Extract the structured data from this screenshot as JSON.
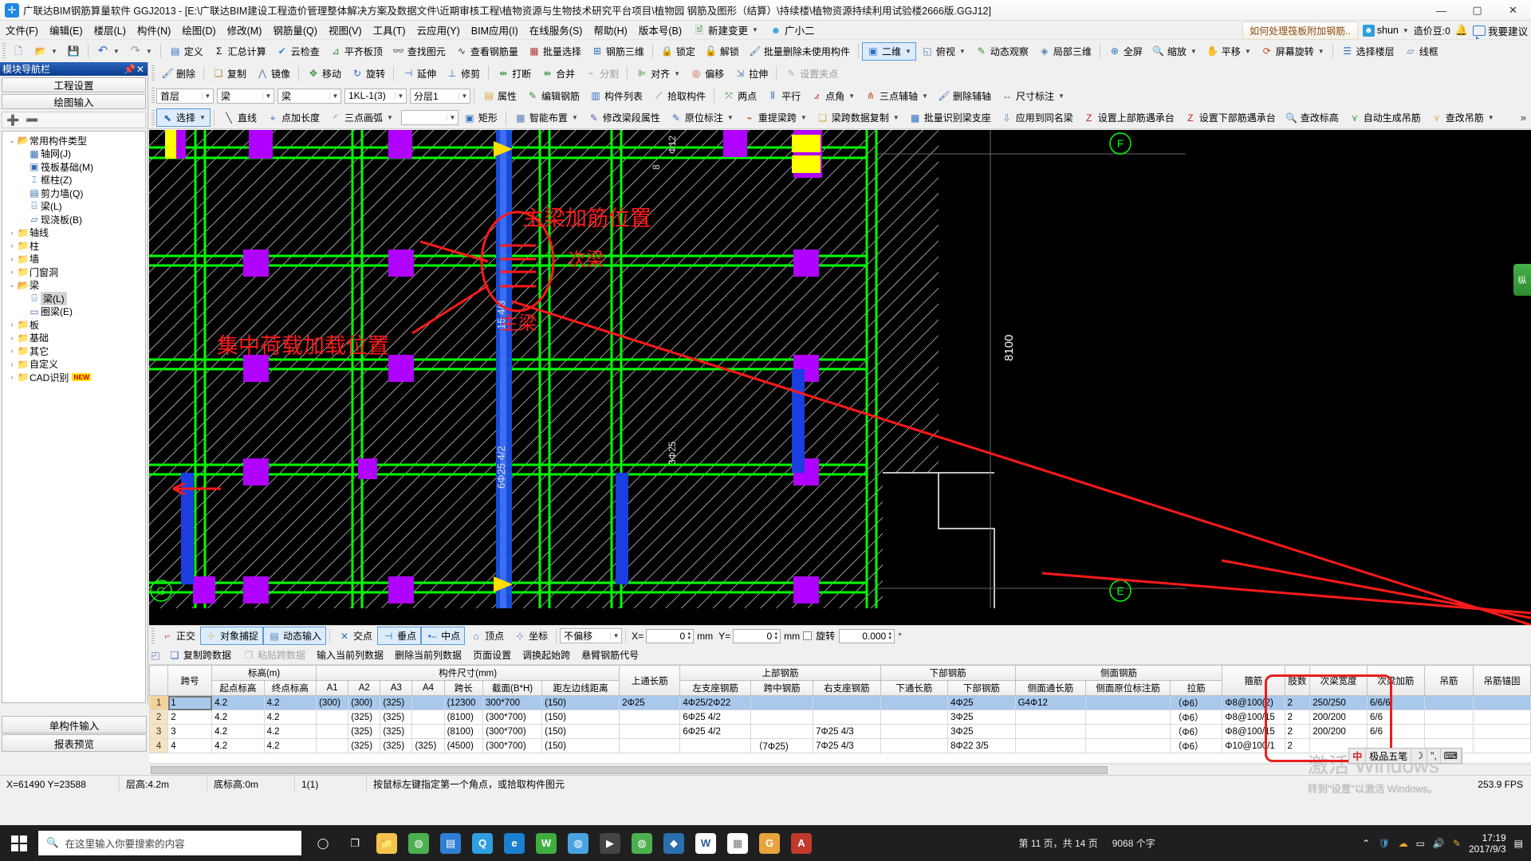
{
  "window": {
    "title": "广联达BIM钢筋算量软件 GGJ2013 - [E:\\广联达BIM建设工程造价管理整体解决方案及数据文件\\近期审核工程\\植物资源与生物技术研究平台项目\\植物园 钢筋及图形（结算）\\持续楼\\植物资源持续利用试验楼2666版.GGJ12]",
    "app_icon": "plus-icon",
    "minimize": "—",
    "maximize": "▢",
    "close": "✕"
  },
  "menubar": {
    "items": [
      "文件(F)",
      "编辑(E)",
      "楼层(L)",
      "构件(N)",
      "绘图(D)",
      "修改(M)",
      "钢筋量(Q)",
      "视图(V)",
      "工具(T)",
      "云应用(Y)",
      "BIM应用(I)",
      "在线服务(S)",
      "帮助(H)",
      "版本号(B)"
    ],
    "new_change": "新建变更",
    "assistant": "广小二",
    "promo": "如何处理筏板附加钢筋..",
    "user": "shun",
    "points": "造价豆:0",
    "feedback": "我要建议"
  },
  "toolbar_main": {
    "items": [
      {
        "label": "",
        "icon": "new-file-icon"
      },
      {
        "label": "",
        "icon": "open-folder-icon",
        "caret": true
      },
      {
        "label": "",
        "icon": "save-icon"
      },
      {
        "label": "",
        "icon": "undo-icon",
        "caret": true
      },
      {
        "label": "",
        "icon": "redo-icon",
        "caret": true
      },
      {
        "label": "定义",
        "icon": "define-icon"
      },
      {
        "label": "汇总计算",
        "icon": "sigma-icon"
      },
      {
        "label": "云检查",
        "icon": "cloud-check-icon"
      },
      {
        "label": "平齐板顶",
        "icon": "align-slab-icon"
      },
      {
        "label": "查找图元",
        "icon": "binoculars-icon"
      },
      {
        "label": "查看钢筋量",
        "icon": "view-rebar-icon"
      },
      {
        "label": "批量选择",
        "icon": "batch-select-icon"
      },
      {
        "label": "钢筋三维",
        "icon": "rebar-3d-icon"
      },
      {
        "label": "锁定",
        "icon": "lock-icon"
      },
      {
        "label": "解锁",
        "icon": "unlock-icon"
      },
      {
        "label": "批量删除未使用构件",
        "icon": "batch-delete-icon"
      },
      {
        "label": "二维",
        "icon": "2d-icon",
        "caret": true
      },
      {
        "label": "俯视",
        "icon": "top-view-icon",
        "caret": true
      },
      {
        "label": "动态观察",
        "icon": "orbit-icon"
      },
      {
        "label": "局部三维",
        "icon": "local-3d-icon"
      },
      {
        "label": "全屏",
        "icon": "fullscreen-icon"
      },
      {
        "label": "缩放",
        "icon": "zoom-icon",
        "caret": true
      },
      {
        "label": "平移",
        "icon": "pan-icon",
        "caret": true
      },
      {
        "label": "屏幕旋转",
        "icon": "screen-rotate-icon",
        "caret": true
      },
      {
        "label": "选择楼层",
        "icon": "select-floor-icon"
      },
      {
        "label": "线框",
        "icon": "wireframe-icon"
      }
    ]
  },
  "toolbar_edit": {
    "items": [
      {
        "label": "删除",
        "icon": "delete-icon"
      },
      {
        "label": "复制",
        "icon": "copy-icon"
      },
      {
        "label": "镜像",
        "icon": "mirror-icon"
      },
      {
        "label": "移动",
        "icon": "move-icon"
      },
      {
        "label": "旋转",
        "icon": "rotate-icon"
      },
      {
        "label": "延伸",
        "icon": "extend-icon"
      },
      {
        "label": "修剪",
        "icon": "trim-icon"
      },
      {
        "label": "打断",
        "icon": "break-icon"
      },
      {
        "label": "合并",
        "icon": "merge-icon"
      },
      {
        "label": "分割",
        "icon": "split-icon"
      },
      {
        "label": "对齐",
        "icon": "align-icon",
        "caret": true
      },
      {
        "label": "偏移",
        "icon": "offset-icon"
      },
      {
        "label": "拉伸",
        "icon": "stretch-icon"
      },
      {
        "label": "设置夹点",
        "icon": "set-grip-icon"
      }
    ]
  },
  "toolbar_context": {
    "floor": "首层",
    "type1": "梁",
    "type2": "梁",
    "member": "1KL-1(3)",
    "layer": "分层1",
    "items": [
      {
        "label": "属性",
        "icon": "properties-icon"
      },
      {
        "label": "编辑钢筋",
        "icon": "edit-rebar-icon"
      },
      {
        "label": "构件列表",
        "icon": "member-list-icon"
      },
      {
        "label": "拾取构件",
        "icon": "pick-member-icon"
      },
      {
        "label": "两点",
        "icon": "two-point-icon"
      },
      {
        "label": "平行",
        "icon": "parallel-icon"
      },
      {
        "label": "点角",
        "icon": "point-angle-icon",
        "caret": true
      },
      {
        "label": "三点辅轴",
        "icon": "three-point-axis-icon",
        "caret": true
      },
      {
        "label": "删除辅轴",
        "icon": "delete-axis-icon"
      },
      {
        "label": "尺寸标注",
        "icon": "dimension-icon",
        "caret": true
      }
    ]
  },
  "toolbar_draw": {
    "items": [
      {
        "label": "选择",
        "icon": "cursor-icon",
        "caret": true,
        "selected": true
      },
      {
        "label": "直线",
        "icon": "line-icon"
      },
      {
        "label": "点加长度",
        "icon": "point-length-icon"
      },
      {
        "label": "三点画弧",
        "icon": "arc-icon",
        "caret": true
      },
      {
        "label": "",
        "icon": "blank-combo",
        "caret": true
      },
      {
        "label": "矩形",
        "icon": "rect-icon"
      },
      {
        "label": "智能布置",
        "icon": "smart-layout-icon",
        "caret": true
      },
      {
        "label": "修改梁段属性",
        "icon": "edit-beam-seg-icon"
      },
      {
        "label": "原位标注",
        "icon": "in-situ-label-icon",
        "caret": true
      },
      {
        "label": "重提梁跨",
        "icon": "re-extract-span-icon",
        "caret": true
      },
      {
        "label": "梁跨数据复制",
        "icon": "span-copy-icon",
        "caret": true
      },
      {
        "label": "批量识别梁支座",
        "icon": "batch-support-icon"
      },
      {
        "label": "应用到同名梁",
        "icon": "apply-same-beam-icon"
      },
      {
        "label": "设置上部筋遇承台",
        "icon": "set-top-rebar-icon"
      },
      {
        "label": "设置下部筋遇承台",
        "icon": "set-bottom-rebar-icon"
      },
      {
        "label": "查改标高",
        "icon": "check-elevation-icon"
      },
      {
        "label": "自动生成吊筋",
        "icon": "auto-hanger-icon"
      },
      {
        "label": "查改吊筋",
        "icon": "check-hanger-icon",
        "caret": true
      }
    ],
    "overflow": "»"
  },
  "left_panel": {
    "title": "模块导航栏",
    "pin_icon": "pin-icon",
    "close_icon": "close-icon",
    "btn_project_settings": "工程设置",
    "btn_drawing_input": "绘图输入",
    "expand_icon": "expand-all-icon",
    "collapse_icon": "collapse-all-icon",
    "tree": [
      {
        "label": "常用构件类型",
        "level": 0,
        "expanded": true,
        "icon": "folder-open-icon"
      },
      {
        "label": "轴网(J)",
        "level": 1,
        "icon": "grid-icon"
      },
      {
        "label": "筏板基础(M)",
        "level": 1,
        "icon": "raft-foundation-icon"
      },
      {
        "label": "框柱(Z)",
        "level": 1,
        "icon": "frame-column-icon"
      },
      {
        "label": "剪力墙(Q)",
        "level": 1,
        "icon": "shear-wall-icon"
      },
      {
        "label": "梁(L)",
        "level": 1,
        "icon": "beam-icon"
      },
      {
        "label": "现浇板(B)",
        "level": 1,
        "icon": "slab-icon"
      },
      {
        "label": "轴线",
        "level": 0,
        "expanded": false,
        "icon": "folder-icon"
      },
      {
        "label": "柱",
        "level": 0,
        "expanded": false,
        "icon": "folder-icon"
      },
      {
        "label": "墙",
        "level": 0,
        "expanded": false,
        "icon": "folder-icon"
      },
      {
        "label": "门窗洞",
        "level": 0,
        "expanded": false,
        "icon": "folder-icon"
      },
      {
        "label": "梁",
        "level": 0,
        "expanded": true,
        "icon": "folder-open-icon"
      },
      {
        "label": "梁(L)",
        "level": 1,
        "icon": "beam-icon",
        "selected": true
      },
      {
        "label": "圈梁(E)",
        "level": 1,
        "icon": "ring-beam-icon"
      },
      {
        "label": "板",
        "level": 0,
        "expanded": false,
        "icon": "folder-icon"
      },
      {
        "label": "基础",
        "level": 0,
        "expanded": false,
        "icon": "folder-icon"
      },
      {
        "label": "其它",
        "level": 0,
        "expanded": false,
        "icon": "folder-icon"
      },
      {
        "label": "自定义",
        "level": 0,
        "expanded": false,
        "icon": "folder-icon"
      },
      {
        "label": "CAD识别",
        "level": 0,
        "expanded": false,
        "icon": "folder-icon",
        "badge": "NEW"
      }
    ],
    "btn_single_member_input": "单构件输入",
    "btn_report_preview": "报表预览"
  },
  "canvas": {
    "annotations": [
      {
        "text": "主梁加筋位置",
        "color": "#ff2020"
      },
      {
        "text": "次梁",
        "color": "#ff2020"
      },
      {
        "text": "主梁",
        "color": "#ff2020"
      },
      {
        "text": "集中荷载加载位置",
        "color": "#ff2020"
      }
    ],
    "dimension_labels": [
      "8100",
      "15 4/3",
      "6Φ25",
      "6Φ25 4/2",
      "8",
      "Φ12"
    ],
    "axis_labels": [
      "F",
      "E",
      "G"
    ],
    "right_tab": "纵"
  },
  "snapbar": {
    "items": [
      {
        "label": "正交",
        "icon": "ortho-icon",
        "active": false
      },
      {
        "label": "对象捕捉",
        "icon": "object-snap-icon",
        "active": true
      },
      {
        "label": "动态输入",
        "icon": "dynamic-input-icon",
        "active": true
      },
      {
        "label": "交点",
        "icon": "intersection-icon",
        "active": false
      },
      {
        "label": "垂点",
        "icon": "perpendicular-icon",
        "active": true
      },
      {
        "label": "中点",
        "icon": "midpoint-icon",
        "active": true
      },
      {
        "label": "顶点",
        "icon": "vertex-icon",
        "active": false
      },
      {
        "label": "坐标",
        "icon": "coordinate-icon",
        "active": false
      }
    ],
    "offset_mode": "不偏移",
    "x_label": "X=",
    "x_value": "0",
    "x_unit": "mm",
    "y_label": "Y=",
    "y_value": "0",
    "y_unit": "mm",
    "rotate_label": "旋转",
    "rotate_value": "0.000",
    "rotate_unit": "°"
  },
  "table_tools": {
    "items": [
      "复制跨数据",
      "粘贴跨数据",
      "输入当前列数据",
      "删除当前列数据",
      "页面设置",
      "调换起始跨",
      "悬臂钢筋代号"
    ],
    "disabled": [
      "粘贴跨数据"
    ]
  },
  "table": {
    "group_headers": [
      {
        "label": "",
        "span": 1
      },
      {
        "label": "跨号",
        "span": 1,
        "rowspan": 2,
        "highlight": true
      },
      {
        "label": "标高(m)",
        "span": 2
      },
      {
        "label": "构件尺寸(mm)",
        "span": 7
      },
      {
        "label": "上通长筋",
        "span": 1,
        "rowspan": 2
      },
      {
        "label": "上部钢筋",
        "span": 3
      },
      {
        "label": "下部钢筋",
        "span": 2
      },
      {
        "label": "侧面钢筋",
        "span": 3
      },
      {
        "label": "箍筋",
        "span": 1,
        "rowspan": 2
      },
      {
        "label": "肢数",
        "span": 1,
        "rowspan": 2
      },
      {
        "label": "次梁宽度",
        "span": 1,
        "rowspan": 2
      },
      {
        "label": "次梁加筋",
        "span": 1,
        "rowspan": 2
      },
      {
        "label": "吊筋",
        "span": 1,
        "rowspan": 2
      },
      {
        "label": "吊筋锚固",
        "span": 1,
        "rowspan": 2
      }
    ],
    "sub_headers": [
      "起点标高",
      "终点标高",
      "A1",
      "A2",
      "A3",
      "A4",
      "跨长",
      "截面(B*H)",
      "距左边线距离",
      "左支座钢筋",
      "跨中钢筋",
      "右支座钢筋",
      "下通长筋",
      "下部钢筋",
      "侧面通长筋",
      "侧面原位标注筋",
      "拉筋"
    ],
    "rows": [
      {
        "no": "1",
        "span_no": "1",
        "start_elev": "4.2",
        "end_elev": "4.2",
        "a1": "(300)",
        "a2": "(300)",
        "a3": "(325)",
        "a4": "",
        "span_len": "(12300",
        "section": "300*700",
        "left_dist": "(150)",
        "top_through": "2Φ25",
        "left_support": "4Φ25/2Φ22",
        "mid_span": "",
        "right_support": "",
        "bottom_through": "",
        "bottom_rebar": "4Φ25",
        "side_through": "G4Φ12",
        "side_insitu": "",
        "tie": "（Φ6）",
        "stirrup": "Φ8@100(2)",
        "legs": "2",
        "sec_beam_width": "250/250",
        "sec_beam_rebar": "6/6/6",
        "hanger": "",
        "hanger_anchor": "",
        "selected": true
      },
      {
        "no": "2",
        "span_no": "2",
        "start_elev": "4.2",
        "end_elev": "4.2",
        "a1": "",
        "a2": "(325)",
        "a3": "(325)",
        "a4": "",
        "span_len": "(8100)",
        "section": "(300*700)",
        "left_dist": "(150)",
        "top_through": "",
        "left_support": "6Φ25 4/2",
        "mid_span": "",
        "right_support": "",
        "bottom_through": "",
        "bottom_rebar": "3Φ25",
        "side_through": "",
        "side_insitu": "",
        "tie": "（Φ6）",
        "stirrup": "Φ8@100/15",
        "legs": "2",
        "sec_beam_width": "200/200",
        "sec_beam_rebar": "6/6",
        "hanger": "",
        "hanger_anchor": "",
        "selected": false
      },
      {
        "no": "3",
        "span_no": "3",
        "start_elev": "4.2",
        "end_elev": "4.2",
        "a1": "",
        "a2": "(325)",
        "a3": "(325)",
        "a4": "",
        "span_len": "(8100)",
        "section": "(300*700)",
        "left_dist": "(150)",
        "top_through": "",
        "left_support": "6Φ25 4/2",
        "mid_span": "",
        "right_support": "7Φ25 4/3",
        "bottom_through": "",
        "bottom_rebar": "3Φ25",
        "side_through": "",
        "side_insitu": "",
        "tie": "（Φ6）",
        "stirrup": "Φ8@100/15",
        "legs": "2",
        "sec_beam_width": "200/200",
        "sec_beam_rebar": "6/6",
        "hanger": "",
        "hanger_anchor": "",
        "selected": false
      },
      {
        "no": "4",
        "span_no": "4",
        "start_elev": "4.2",
        "end_elev": "4.2",
        "a1": "",
        "a2": "(325)",
        "a3": "(325)",
        "a4": "(325)",
        "span_len": "(4500)",
        "section": "(300*700)",
        "left_dist": "(150)",
        "top_through": "",
        "left_support": "",
        "mid_span": "（7Φ25)",
        "right_support": "7Φ25 4/3",
        "bottom_through": "",
        "bottom_rebar": "8Φ22 3/5",
        "side_through": "",
        "side_insitu": "",
        "tie": "（Φ6）",
        "stirrup": "Φ10@100/1",
        "legs": "2",
        "sec_beam_width": "",
        "sec_beam_rebar": "",
        "hanger": "",
        "hanger_anchor": "",
        "selected": false
      }
    ]
  },
  "statusbar": {
    "coords": "X=61490  Y=23588",
    "floor_height": "层高:4.2m",
    "base_elev": "底标高:0m",
    "span_indicator": "1(1)",
    "hint": "按鼠标左键指定第一个角点，或拾取构件图元",
    "fps": "253.9 FPS"
  },
  "watermark": {
    "line1": "激活 Windows",
    "line2": "转到\"设置\"以激活 Windows。"
  },
  "ime": {
    "lang": "中",
    "method": "极品五笔",
    "icons": [
      "moon-icon",
      "punct-icon",
      "keyboard-icon"
    ]
  },
  "taskbar": {
    "start_icon": "windows-icon",
    "search_placeholder": "在这里输入你要搜索的内容",
    "search_icon": "search-icon",
    "cortana_icon": "cortana-icon",
    "taskview_icon": "task-view-icon",
    "doc_info": [
      "第 11 页，共 14 页",
      "9068 个字"
    ],
    "clock_time": "17:19",
    "clock_date": "2017/9/3",
    "tray_icons": [
      "caret-up-icon",
      "shield-icon",
      "onedrive-icon",
      "network-icon",
      "volume-icon",
      "pen-icon",
      "notification-icon"
    ]
  },
  "colors": {
    "accent": "#2d7fd3",
    "annotation_red": "#ff2020",
    "selection_blue": "#a8c8ec",
    "canvas_bg": "#000000",
    "beam_green": "#00ff00",
    "column_purple": "#b000ff",
    "rebar_blue": "#1a4ee0",
    "highlight_yellow": "#ffff00"
  }
}
